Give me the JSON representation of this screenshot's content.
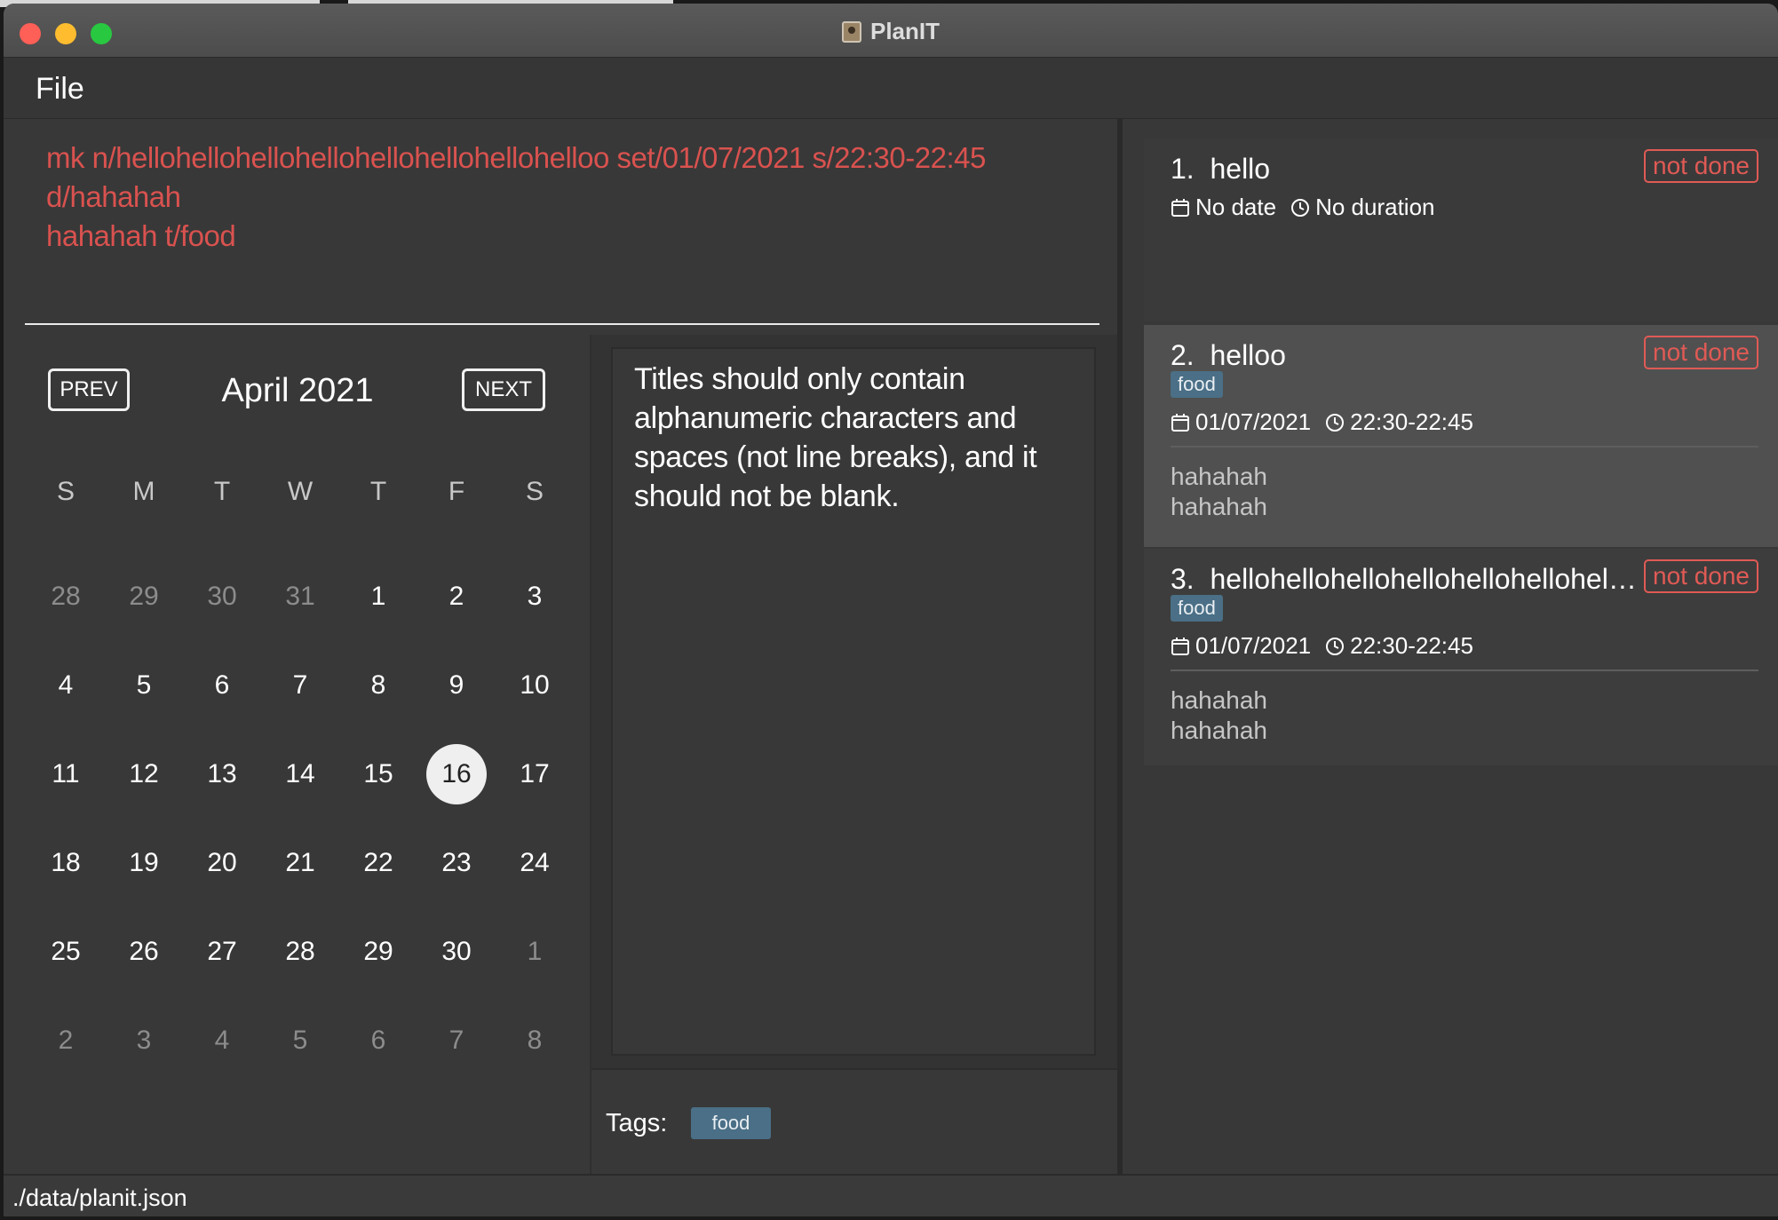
{
  "window": {
    "title": "PlanIT"
  },
  "menu": {
    "file_label": "File"
  },
  "command": {
    "text": "mk n/hellohellohellohellohellohellohellohelloo set/01/07/2021 s/22:30-22:45\nd/hahahah\nhahahah t/food"
  },
  "calendar": {
    "prev_label": "PREV",
    "next_label": "NEXT",
    "month_label": "April 2021",
    "weekdays": [
      "S",
      "M",
      "T",
      "W",
      "T",
      "F",
      "S"
    ],
    "weeks": [
      [
        "28",
        "29",
        "30",
        "31",
        "1",
        "2",
        "3"
      ],
      [
        "4",
        "5",
        "6",
        "7",
        "8",
        "9",
        "10"
      ],
      [
        "11",
        "12",
        "13",
        "14",
        "15",
        "16",
        "17"
      ],
      [
        "18",
        "19",
        "20",
        "21",
        "22",
        "23",
        "24"
      ],
      [
        "25",
        "26",
        "27",
        "28",
        "29",
        "30",
        "1"
      ],
      [
        "2",
        "3",
        "4",
        "5",
        "6",
        "7",
        "8"
      ]
    ],
    "selected_day": "16"
  },
  "result": {
    "message": "Titles should only contain alphanumeric characters and spaces (not line breaks), and it should not be blank."
  },
  "tags_panel": {
    "label": "Tags:",
    "tags": [
      "food"
    ]
  },
  "tasks": [
    {
      "index": "1.",
      "title": "hello",
      "status": "not done",
      "tag": "",
      "date": "No date",
      "duration": "No duration",
      "description": []
    },
    {
      "index": "2.",
      "title": "helloo",
      "status": "not done",
      "tag": "food",
      "date": "01/07/2021",
      "duration": "22:30-22:45",
      "description": [
        "hahahah",
        "hahahah"
      ]
    },
    {
      "index": "3.",
      "title": "hellohellohellohellohellohellohello...",
      "status": "not done",
      "tag": "food",
      "date": "01/07/2021",
      "duration": "22:30-22:45",
      "description": [
        "hahahah",
        "hahahah"
      ]
    }
  ],
  "status_bar": {
    "path": "./data/planit.json"
  },
  "colors": {
    "status_not_done": "#e05a55",
    "tag_bg": "#4a6f86",
    "command_text": "#d9524f"
  }
}
